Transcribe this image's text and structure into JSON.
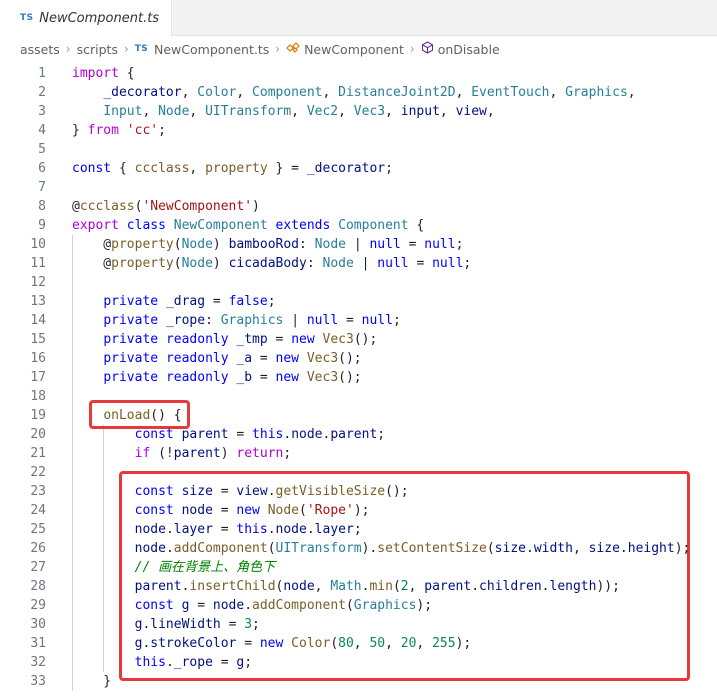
{
  "tab": {
    "icon": "TS",
    "label": "NewComponent.ts"
  },
  "breadcrumb": [
    {
      "icon": "",
      "label": "assets"
    },
    {
      "icon": "",
      "label": "scripts"
    },
    {
      "icon": "TS",
      "label": "NewComponent.ts"
    },
    {
      "icon": "class-icon",
      "label": "NewComponent"
    },
    {
      "icon": "method-icon",
      "label": "onDisable"
    }
  ],
  "colors": {
    "keyword": "#0000ff",
    "control": "#af00db",
    "function": "#795e26",
    "type": "#267f99",
    "string": "#a31515",
    "number": "#098658",
    "comment": "#008000",
    "highlight": "#e5393c"
  },
  "editor": {
    "lines": [
      {
        "n": "1",
        "tokens": [
          [
            "kc",
            "import"
          ],
          [
            "",
            "{"
          ]
        ]
      },
      {
        "n": "2",
        "tokens": [
          [
            "",
            "    "
          ],
          [
            "pm",
            "_decorator"
          ],
          [
            "",
            ", "
          ],
          [
            "ty",
            "Color"
          ],
          [
            "",
            ", "
          ],
          [
            "ty",
            "Component"
          ],
          [
            "",
            ", "
          ],
          [
            "ty",
            "DistanceJoint2D"
          ],
          [
            "",
            ", "
          ],
          [
            "ty",
            "EventTouch"
          ],
          [
            "",
            ", "
          ],
          [
            "ty",
            "Graphics"
          ],
          [
            "",
            ","
          ]
        ]
      },
      {
        "n": "3",
        "tokens": [
          [
            "",
            "    "
          ],
          [
            "ty",
            "Input"
          ],
          [
            "",
            ", "
          ],
          [
            "ty",
            "Node"
          ],
          [
            "",
            ", "
          ],
          [
            "ty",
            "UITransform"
          ],
          [
            "",
            ", "
          ],
          [
            "ty",
            "Vec2"
          ],
          [
            "",
            ", "
          ],
          [
            "ty",
            "Vec3"
          ],
          [
            "",
            ", "
          ],
          [
            "pm",
            "input"
          ],
          [
            "",
            ", "
          ],
          [
            "pm",
            "view"
          ],
          [
            "",
            ","
          ]
        ]
      },
      {
        "n": "4",
        "tokens": [
          [
            "",
            "} "
          ],
          [
            "kc",
            "from"
          ],
          [
            "",
            ""
          ],
          [
            "str",
            "'cc'"
          ],
          [
            "",
            ";"
          ]
        ]
      },
      {
        "n": "5",
        "tokens": []
      },
      {
        "n": "6",
        "tokens": [
          [
            "kw",
            "const"
          ],
          [
            "",
            ""
          ],
          [
            "",
            "{ "
          ],
          [
            "fn",
            "ccclass"
          ],
          [
            "",
            ", "
          ],
          [
            "fn",
            "property"
          ],
          [
            "",
            ""
          ],
          [
            "",
            "} = "
          ],
          [
            "pm",
            "_decorator"
          ],
          [
            "",
            ";"
          ]
        ]
      },
      {
        "n": "7",
        "tokens": []
      },
      {
        "n": "8",
        "tokens": [
          [
            "",
            "@"
          ],
          [
            "fn",
            "ccclass"
          ],
          [
            "",
            "("
          ],
          [
            "str",
            "'NewComponent'"
          ],
          [
            "",
            ")"
          ]
        ]
      },
      {
        "n": "9",
        "tokens": [
          [
            "kc",
            "export"
          ],
          [
            "kw",
            "class"
          ],
          [
            "ty",
            "NewComponent"
          ],
          [
            "kw",
            "extends"
          ],
          [
            "ty",
            "Component"
          ],
          [
            "",
            "{"
          ]
        ]
      },
      {
        "n": "10",
        "tokens": [
          [
            "",
            "    @"
          ],
          [
            "fn",
            "property"
          ],
          [
            "",
            "("
          ],
          [
            "ty",
            "Node"
          ],
          [
            "",
            ") "
          ],
          [
            "pm",
            "bambooRod"
          ],
          [
            "",
            ": "
          ],
          [
            "ty",
            "Node"
          ],
          [
            "",
            ""
          ],
          [
            "",
            "| "
          ],
          [
            "kw",
            "null"
          ],
          [
            "",
            ""
          ],
          [
            "",
            "= "
          ],
          [
            "kw",
            "null"
          ],
          [
            "",
            ";"
          ]
        ]
      },
      {
        "n": "11",
        "tokens": [
          [
            "",
            "    @"
          ],
          [
            "fn",
            "property"
          ],
          [
            "",
            "("
          ],
          [
            "ty",
            "Node"
          ],
          [
            "",
            ") "
          ],
          [
            "pm",
            "cicadaBody"
          ],
          [
            "",
            ": "
          ],
          [
            "ty",
            "Node"
          ],
          [
            "",
            ""
          ],
          [
            "",
            "| "
          ],
          [
            "kw",
            "null"
          ],
          [
            "",
            ""
          ],
          [
            "",
            "= "
          ],
          [
            "kw",
            "null"
          ],
          [
            "",
            ";"
          ]
        ]
      },
      {
        "n": "12",
        "tokens": []
      },
      {
        "n": "13",
        "tokens": [
          [
            "",
            "    "
          ],
          [
            "kw",
            "private"
          ],
          [
            "pm",
            "_drag"
          ],
          [
            "",
            ""
          ],
          [
            "",
            "= "
          ],
          [
            "kw",
            "false"
          ],
          [
            "",
            ";"
          ]
        ]
      },
      {
        "n": "14",
        "tokens": [
          [
            "",
            "    "
          ],
          [
            "kw",
            "private"
          ],
          [
            "pm",
            "_rope"
          ],
          [
            "",
            ": "
          ],
          [
            "ty",
            "Graphics"
          ],
          [
            "",
            ""
          ],
          [
            "",
            "| "
          ],
          [
            "kw",
            "null"
          ],
          [
            "",
            ""
          ],
          [
            "",
            "= "
          ],
          [
            "kw",
            "null"
          ],
          [
            "",
            ";"
          ]
        ]
      },
      {
        "n": "15",
        "tokens": [
          [
            "",
            "    "
          ],
          [
            "kw",
            "private"
          ],
          [
            "kw",
            "readonly"
          ],
          [
            "pm",
            "_tmp"
          ],
          [
            "",
            ""
          ],
          [
            "",
            "= "
          ],
          [
            "kw",
            "new"
          ],
          [
            "fn",
            "Vec3"
          ],
          [
            "",
            "();"
          ]
        ]
      },
      {
        "n": "16",
        "tokens": [
          [
            "",
            "    "
          ],
          [
            "kw",
            "private"
          ],
          [
            "kw",
            "readonly"
          ],
          [
            "pm",
            "_a"
          ],
          [
            "",
            ""
          ],
          [
            "",
            "= "
          ],
          [
            "kw",
            "new"
          ],
          [
            "fn",
            "Vec3"
          ],
          [
            "",
            "();"
          ]
        ]
      },
      {
        "n": "17",
        "tokens": [
          [
            "",
            "    "
          ],
          [
            "kw",
            "private"
          ],
          [
            "kw",
            "readonly"
          ],
          [
            "pm",
            "_b"
          ],
          [
            "",
            ""
          ],
          [
            "",
            "= "
          ],
          [
            "kw",
            "new"
          ],
          [
            "fn",
            "Vec3"
          ],
          [
            "",
            "();"
          ]
        ]
      },
      {
        "n": "18",
        "tokens": []
      },
      {
        "n": "19",
        "tokens": [
          [
            "",
            "    "
          ],
          [
            "fn",
            "onLoad"
          ],
          [
            "",
            "() {"
          ]
        ]
      },
      {
        "n": "20",
        "tokens": [
          [
            "",
            "        "
          ],
          [
            "kw",
            "const"
          ],
          [
            "pm",
            "parent"
          ],
          [
            "",
            ""
          ],
          [
            "",
            "= "
          ],
          [
            "kw",
            "this"
          ],
          [
            "",
            "."
          ],
          [
            "pm",
            "node"
          ],
          [
            "",
            "."
          ],
          [
            "pm",
            "parent"
          ],
          [
            "",
            ";"
          ]
        ]
      },
      {
        "n": "21",
        "tokens": [
          [
            "",
            "        "
          ],
          [
            "kc",
            "if"
          ],
          [
            "",
            "(!"
          ],
          [
            "pm",
            "parent"
          ],
          [
            "",
            ") "
          ],
          [
            "kc",
            "return"
          ],
          [
            "",
            ";"
          ]
        ]
      },
      {
        "n": "22",
        "tokens": []
      },
      {
        "n": "23",
        "tokens": [
          [
            "",
            "        "
          ],
          [
            "kw",
            "const"
          ],
          [
            "pm",
            "size"
          ],
          [
            "",
            ""
          ],
          [
            "",
            "= "
          ],
          [
            "pm",
            "view"
          ],
          [
            "",
            "."
          ],
          [
            "fn",
            "getVisibleSize"
          ],
          [
            "",
            "();"
          ]
        ]
      },
      {
        "n": "24",
        "tokens": [
          [
            "",
            "        "
          ],
          [
            "kw",
            "const"
          ],
          [
            "pm",
            "node"
          ],
          [
            "",
            ""
          ],
          [
            "",
            "= "
          ],
          [
            "kw",
            "new"
          ],
          [
            "fn",
            "Node"
          ],
          [
            "",
            "("
          ],
          [
            "str",
            "'Rope'"
          ],
          [
            "",
            ");"
          ]
        ]
      },
      {
        "n": "25",
        "tokens": [
          [
            "",
            "        "
          ],
          [
            "pm",
            "node"
          ],
          [
            "",
            "."
          ],
          [
            "pm",
            "layer"
          ],
          [
            "",
            ""
          ],
          [
            "",
            "= "
          ],
          [
            "kw",
            "this"
          ],
          [
            "",
            "."
          ],
          [
            "pm",
            "node"
          ],
          [
            "",
            "."
          ],
          [
            "pm",
            "layer"
          ],
          [
            "",
            ";"
          ]
        ]
      },
      {
        "n": "26",
        "tokens": [
          [
            "",
            "        "
          ],
          [
            "pm",
            "node"
          ],
          [
            "",
            "."
          ],
          [
            "fn",
            "addComponent"
          ],
          [
            "",
            "("
          ],
          [
            "ty",
            "UITransform"
          ],
          [
            "",
            ")."
          ],
          [
            "fn",
            "setContentSize"
          ],
          [
            "",
            "("
          ],
          [
            "pm",
            "size"
          ],
          [
            "",
            "."
          ],
          [
            "pm",
            "width"
          ],
          [
            "",
            ", "
          ],
          [
            "pm",
            "size"
          ],
          [
            "",
            "."
          ],
          [
            "pm",
            "height"
          ],
          [
            "",
            ");"
          ]
        ]
      },
      {
        "n": "27",
        "tokens": [
          [
            "",
            "        "
          ],
          [
            "cm",
            "// 画在背景上、角色下"
          ]
        ]
      },
      {
        "n": "28",
        "tokens": [
          [
            "",
            "        "
          ],
          [
            "pm",
            "parent"
          ],
          [
            "",
            "."
          ],
          [
            "fn",
            "insertChild"
          ],
          [
            "",
            "("
          ],
          [
            "pm",
            "node"
          ],
          [
            "",
            ", "
          ],
          [
            "ty",
            "Math"
          ],
          [
            "",
            "."
          ],
          [
            "fn",
            "min"
          ],
          [
            "",
            "("
          ],
          [
            "num",
            "2"
          ],
          [
            "",
            ", "
          ],
          [
            "pm",
            "parent"
          ],
          [
            "",
            "."
          ],
          [
            "pm",
            "children"
          ],
          [
            "",
            "."
          ],
          [
            "pm",
            "length"
          ],
          [
            "",
            "));"
          ]
        ]
      },
      {
        "n": "29",
        "tokens": [
          [
            "",
            "        "
          ],
          [
            "kw",
            "const"
          ],
          [
            "pm",
            "g"
          ],
          [
            "",
            ""
          ],
          [
            "",
            "= "
          ],
          [
            "pm",
            "node"
          ],
          [
            "",
            "."
          ],
          [
            "fn",
            "addComponent"
          ],
          [
            "",
            "("
          ],
          [
            "ty",
            "Graphics"
          ],
          [
            "",
            ");"
          ]
        ]
      },
      {
        "n": "30",
        "tokens": [
          [
            "",
            "        "
          ],
          [
            "pm",
            "g"
          ],
          [
            "",
            "."
          ],
          [
            "pm",
            "lineWidth"
          ],
          [
            "",
            ""
          ],
          [
            "",
            "= "
          ],
          [
            "num",
            "3"
          ],
          [
            "",
            ";"
          ]
        ]
      },
      {
        "n": "31",
        "tokens": [
          [
            "",
            "        "
          ],
          [
            "pm",
            "g"
          ],
          [
            "",
            "."
          ],
          [
            "pm",
            "strokeColor"
          ],
          [
            "",
            ""
          ],
          [
            "",
            "= "
          ],
          [
            "kw",
            "new"
          ],
          [
            "fn",
            "Color"
          ],
          [
            "",
            "("
          ],
          [
            "num",
            "80"
          ],
          [
            "",
            ", "
          ],
          [
            "num",
            "50"
          ],
          [
            "",
            ", "
          ],
          [
            "num",
            "20"
          ],
          [
            "",
            ", "
          ],
          [
            "num",
            "255"
          ],
          [
            "",
            ");"
          ]
        ]
      },
      {
        "n": "32",
        "tokens": [
          [
            "",
            "        "
          ],
          [
            "kw",
            "this"
          ],
          [
            "",
            "."
          ],
          [
            "pm",
            "_rope"
          ],
          [
            "",
            ""
          ],
          [
            "",
            "= "
          ],
          [
            "pm",
            "g"
          ],
          [
            "",
            ";"
          ]
        ]
      },
      {
        "n": "33",
        "tokens": [
          [
            "",
            "    }"
          ]
        ]
      }
    ]
  }
}
